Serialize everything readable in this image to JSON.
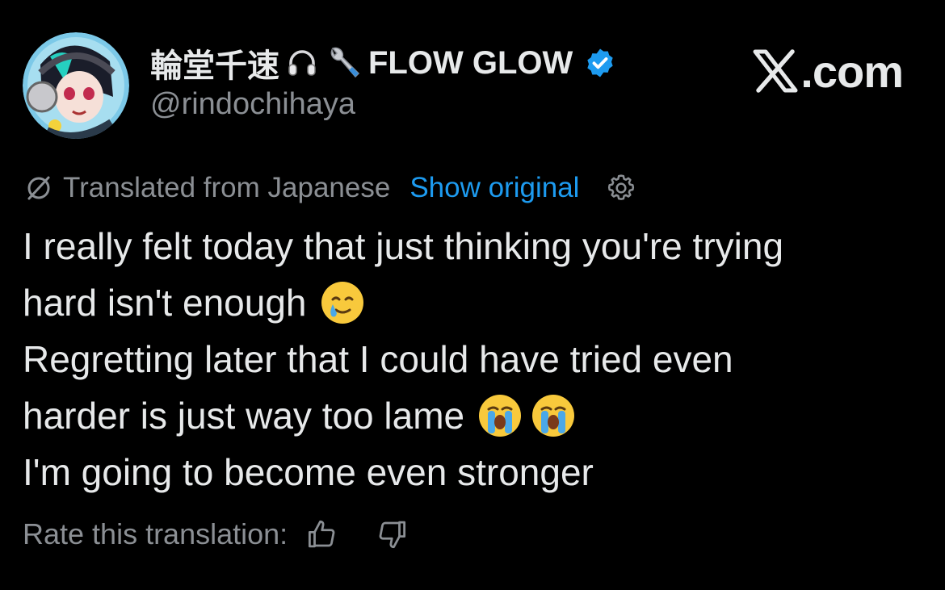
{
  "author": {
    "name": "輪堂千速",
    "name_suffix": "FLOW GLOW",
    "handle": "@rindochihaya",
    "verified_badge_color": "#1d9bf0",
    "avatar_icon": "avatar-image",
    "name_icons": [
      "headphones-icon",
      "wrench-icon"
    ]
  },
  "site": {
    "logo_text": ".com",
    "logo_icon": "x-logo-icon"
  },
  "translation": {
    "label": "Translated from Japanese",
    "show_original": "Show original",
    "settings_icon": "gear-icon",
    "label_icon": "translate-slash-icon"
  },
  "post": {
    "lines": [
      "I really felt today that just thinking you're trying",
      "hard isn't enough",
      "Regretting later that I could have tried even",
      "harder is just way too lame",
      "I'm going to become even stronger"
    ],
    "emojis": [
      "smiling-face-with-tear-emoji",
      "loudly-crying-face-emoji",
      "loudly-crying-face-emoji"
    ]
  },
  "rating": {
    "label": "Rate this translation:",
    "thumbs_up_icon": "thumbs-up-icon",
    "thumbs_down_icon": "thumbs-down-icon"
  },
  "colors": {
    "background": "#000000",
    "text": "#e7e9ea",
    "muted": "#8b8f94",
    "link": "#1d9bf0"
  }
}
